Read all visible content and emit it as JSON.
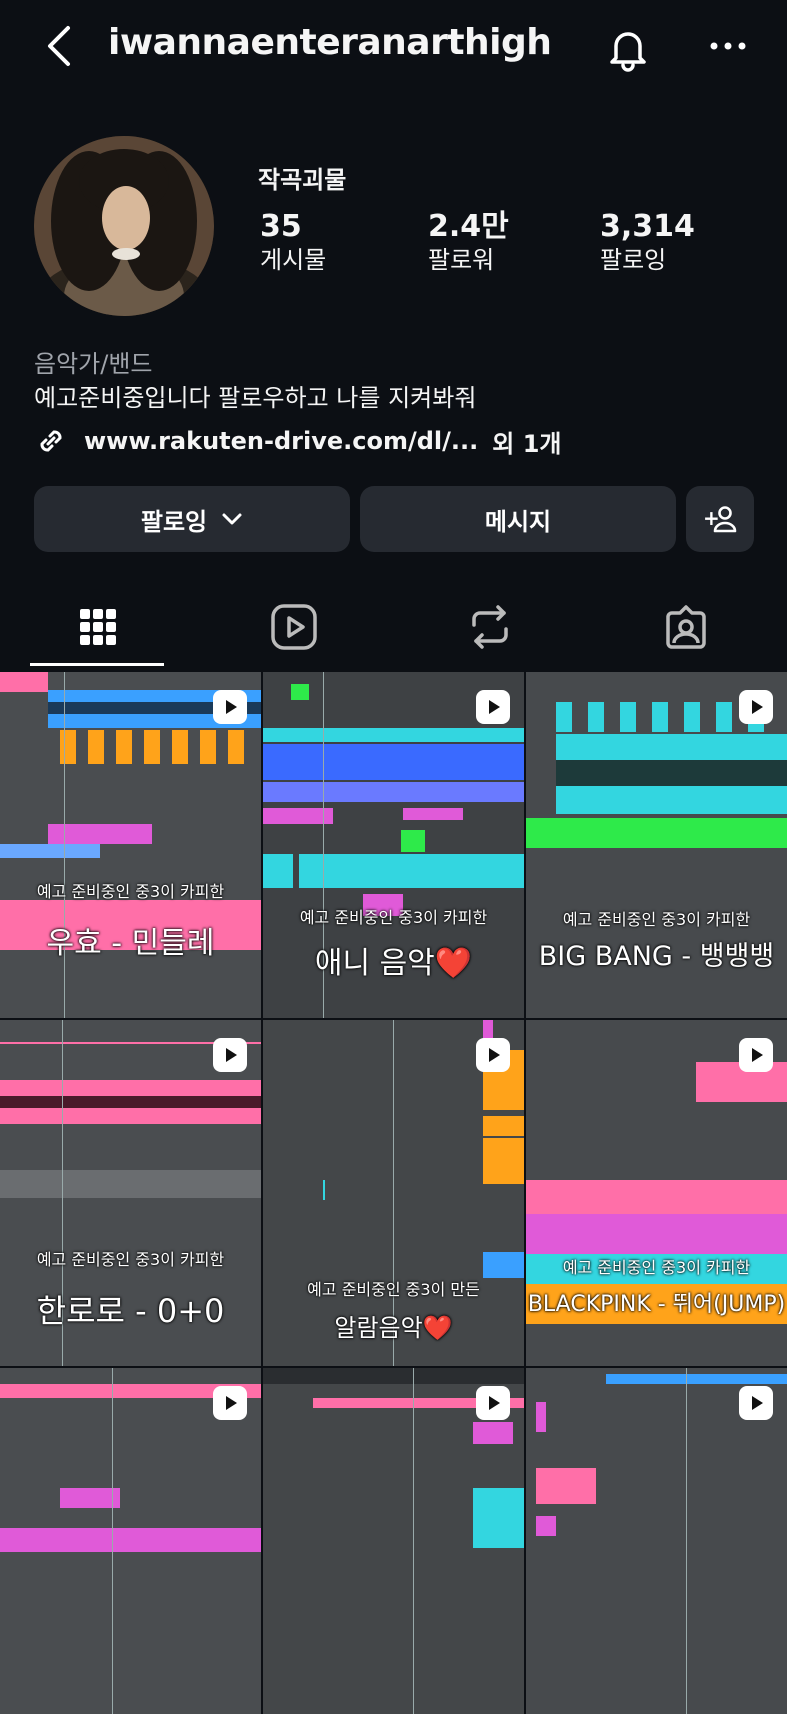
{
  "header": {
    "username": "iwannaenteranarthigh",
    "icons": {
      "back": "chevron-left-icon",
      "notifications": "bell-icon",
      "more": "more-horizontal-icon"
    }
  },
  "profile": {
    "display_name": "작곡괴물",
    "stats": [
      {
        "value": "35",
        "label": "게시물"
      },
      {
        "value": "2.4만",
        "label": "팔로워"
      },
      {
        "value": "3,314",
        "label": "팔로잉"
      }
    ],
    "category": "음악가/밴드",
    "bio": "예고준비중입니다 팔로우하고 나를 지켜봐줘",
    "link": {
      "text": "www.rakuten-drive.com/dl/...",
      "extra": "외 1개"
    }
  },
  "actions": {
    "follow_label": "팔로잉",
    "message_label": "메시지",
    "add_label": "+"
  },
  "tabs": [
    "grid-icon",
    "reels-icon",
    "repost-icon",
    "tagged-icon"
  ],
  "posts": [
    {
      "small": "예고 준비중인 중3이 카피한",
      "big": "우효 - 민들레"
    },
    {
      "small": "예고 준비중인 중3이 카피한",
      "big": "애니 음악❤️"
    },
    {
      "small": "예고 준비중인 중3이 카피한",
      "big": "BIG BANG - 뱅뱅뱅"
    },
    {
      "small": "예고 준비중인 중3이 카피한",
      "big": "한로로 - 0+0"
    },
    {
      "small": "예고 준비중인 중3이 만든",
      "big": "알람음악❤️"
    },
    {
      "small": "예고 준비중인 중3이 카피한",
      "big": "BLACKPINK - 뛰어(JUMP)"
    },
    {
      "small": "",
      "big": ""
    },
    {
      "small": "",
      "big": ""
    },
    {
      "small": "",
      "big": ""
    }
  ],
  "colors": {
    "background": "#0c0f14",
    "button": "#262a31",
    "muted_text": "#a0a4ab",
    "track_blue": "#3aa0ff",
    "track_orange": "#ffa31a",
    "track_pink": "#ff6fa8",
    "track_cyan": "#33d6e0",
    "track_green": "#2eea4a",
    "track_magenta": "#e05ad8"
  }
}
